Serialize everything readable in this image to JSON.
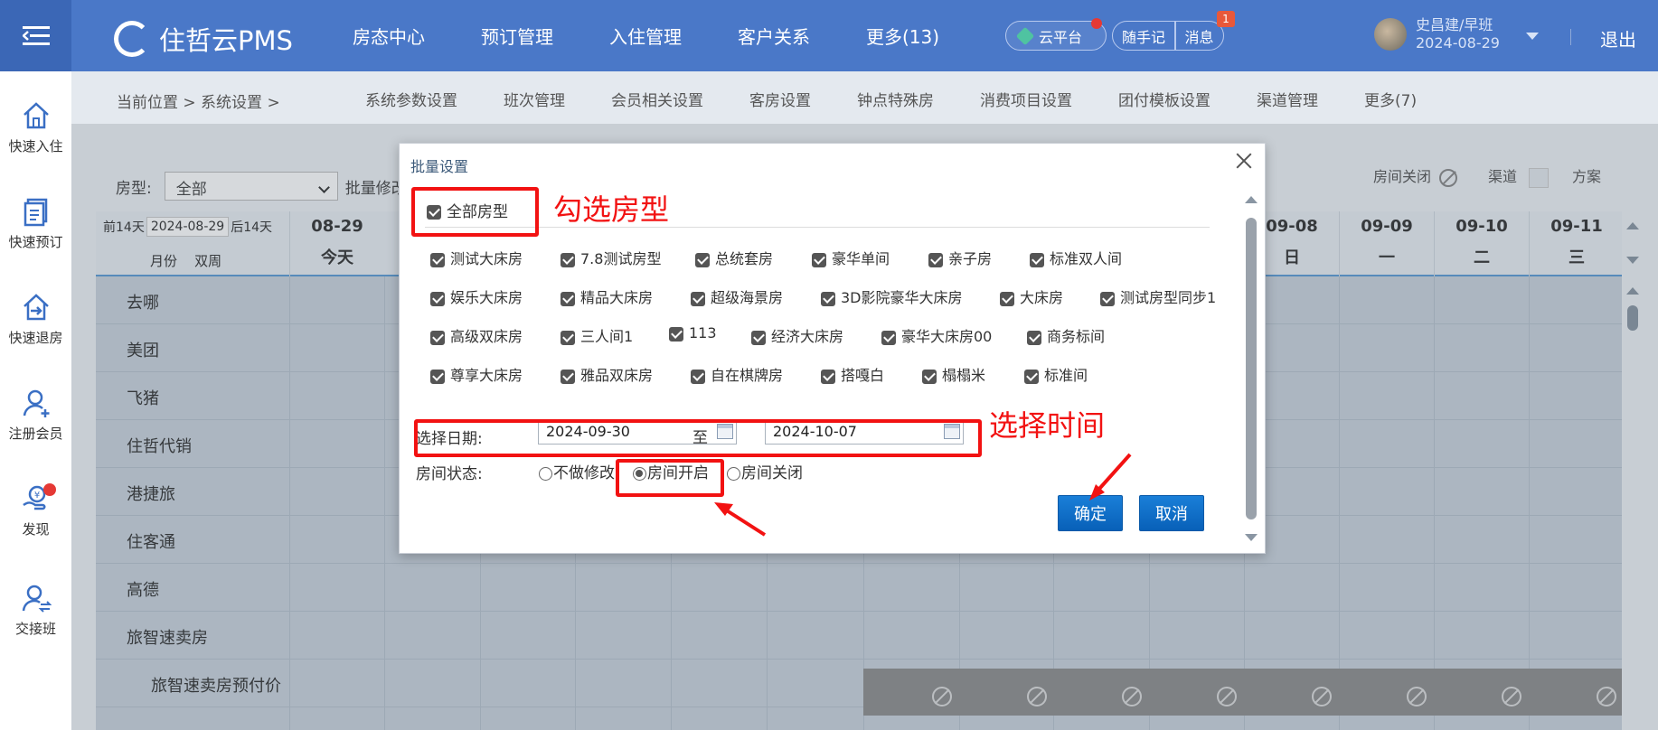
{
  "app": {
    "name": "住哲云PMS",
    "nav": [
      "房态中心",
      "预订管理",
      "入住管理",
      "客户关系",
      "更多(13)"
    ],
    "cloud_label": "云平台",
    "note_label": "随手记",
    "msg_label": "消息",
    "msg_count": "1",
    "user_name": "史昌建/早班",
    "user_date": "2024-08-29",
    "logout": "退出"
  },
  "sidebar": {
    "items": [
      {
        "label": "快速入住",
        "icon": "home-icon"
      },
      {
        "label": "快速预订",
        "icon": "booking-icon"
      },
      {
        "label": "快速退房",
        "icon": "checkout-icon"
      },
      {
        "label": "注册会员",
        "icon": "add-member-icon"
      },
      {
        "label": "发现",
        "icon": "discover-icon"
      },
      {
        "label": "交接班",
        "icon": "shift-handover-icon"
      }
    ]
  },
  "subnav": {
    "breadcrumb": "当前位置 > 系统设置 >",
    "items": [
      "系统参数设置",
      "班次管理",
      "会员相关设置",
      "客房设置",
      "钟点特殊房",
      "消费项目设置",
      "团付模板设置",
      "渠道管理",
      "更多(7)"
    ]
  },
  "filter": {
    "room_type_label": "房型:",
    "room_type_value": "全部",
    "batch_label": "批量修改"
  },
  "legend": {
    "room_closed": "房间关闭",
    "channel": "渠道",
    "plan": "方案"
  },
  "grid": {
    "prev": "前14天",
    "start_date": "2024-08-29",
    "next": "后14天",
    "month": "月份",
    "biweek": "双周",
    "first_day": {
      "date": "08-29",
      "week": "今天"
    },
    "right_days": [
      {
        "date": "09-08",
        "week": "日"
      },
      {
        "date": "09-09",
        "week": "一"
      },
      {
        "date": "09-10",
        "week": "二"
      },
      {
        "date": "09-11",
        "week": "三"
      }
    ],
    "rows": [
      "去哪",
      "美团",
      "飞猪",
      "住哲代销",
      "港捷旅",
      "住客通",
      "高德",
      "旅智速卖房",
      "旅智速卖房预付价"
    ]
  },
  "dialog": {
    "title": "批量设置",
    "all_types": "全部房型",
    "room_types": [
      [
        "测试大床房",
        "7.8测试房型",
        "总统套房",
        "豪华单间",
        "亲子房",
        "标准双人间"
      ],
      [
        "娱乐大床房",
        "精品大床房",
        "超级海景房",
        "3D影院豪华大床房",
        "大床房",
        "测试房型同步1"
      ],
      [
        "高级双床房",
        "三人间1",
        "113",
        "经济大床房",
        "豪华大床房00",
        "商务标间"
      ],
      [
        "尊享大床房",
        "雅品双床房",
        "自在棋牌房",
        "搭嘎白",
        "榻榻米",
        "标准间"
      ]
    ],
    "date_label": "选择日期:",
    "date_from": "2024-09-30",
    "to": "至",
    "date_to": "2024-10-07",
    "status_label": "房间状态:",
    "status_options": [
      "不做修改",
      "房间开启",
      "房间关闭"
    ],
    "status_selected": "房间开启",
    "confirm": "确定",
    "cancel": "取消"
  },
  "annotations": {
    "select_type": "勾选房型",
    "select_time": "选择时间"
  },
  "colors": {
    "topbar": "#4a78c8",
    "annotation": "#f21212",
    "button": "#0a6fd0"
  }
}
